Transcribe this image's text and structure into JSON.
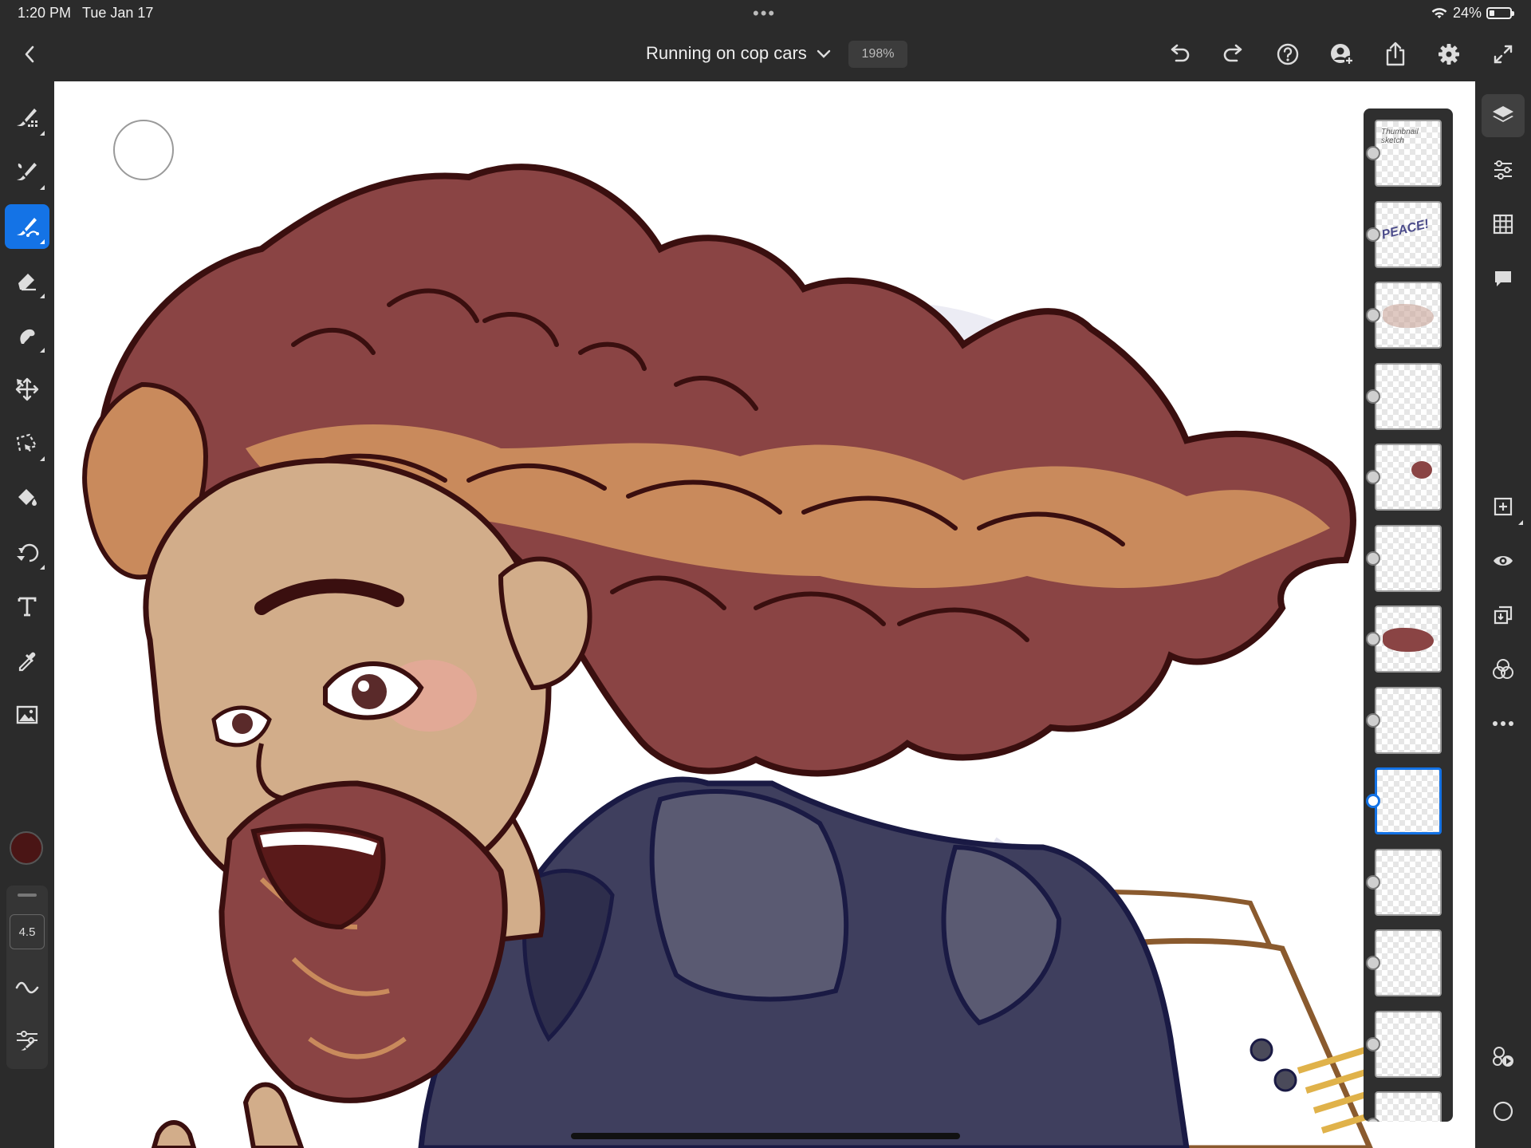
{
  "status_bar": {
    "time": "1:20 PM",
    "date": "Tue Jan 17",
    "battery": "24%",
    "battery_level": 0.24,
    "more_icon": "ellipsis-icon"
  },
  "app_bar": {
    "back_icon": "chevron-left-icon",
    "document_title": "Running on cop cars",
    "zoom": "198%",
    "actions": [
      "undo-icon",
      "redo-icon",
      "help-icon",
      "invite-icon",
      "share-icon",
      "settings-icon",
      "fullscreen-icon"
    ]
  },
  "left_toolbar": {
    "tools": [
      "pixel-brush",
      "live-brush",
      "vector-brush",
      "eraser",
      "smudge",
      "transform",
      "selection",
      "fill",
      "liquify",
      "text",
      "eyedropper",
      "place-image"
    ],
    "active_tool": "vector-brush",
    "current_color": "#4a1515",
    "brush_size": "4.5"
  },
  "layers": {
    "count": 13,
    "selected_index": 8,
    "thumb_texts": [
      "Thumbnail sketch",
      "PEACE!"
    ]
  },
  "right_rail": {
    "top_items": [
      "layers-icon",
      "layer-properties-icon",
      "grid-icon",
      "comments-icon"
    ],
    "bottom_items": [
      "add-layer-icon",
      "visibility-icon",
      "merge-icon",
      "blend-mode-icon",
      "more-icon",
      "timelapse-icon",
      "mask-icon"
    ]
  },
  "colors": {
    "accent": "#1473e6",
    "chrome": "#2b2b2b",
    "hair_dark": "#8a4444",
    "hair_light": "#c98a5c",
    "skin": "#d2ad8a",
    "jacket": "#3f3f5e",
    "outline": "#3a0f0f"
  }
}
